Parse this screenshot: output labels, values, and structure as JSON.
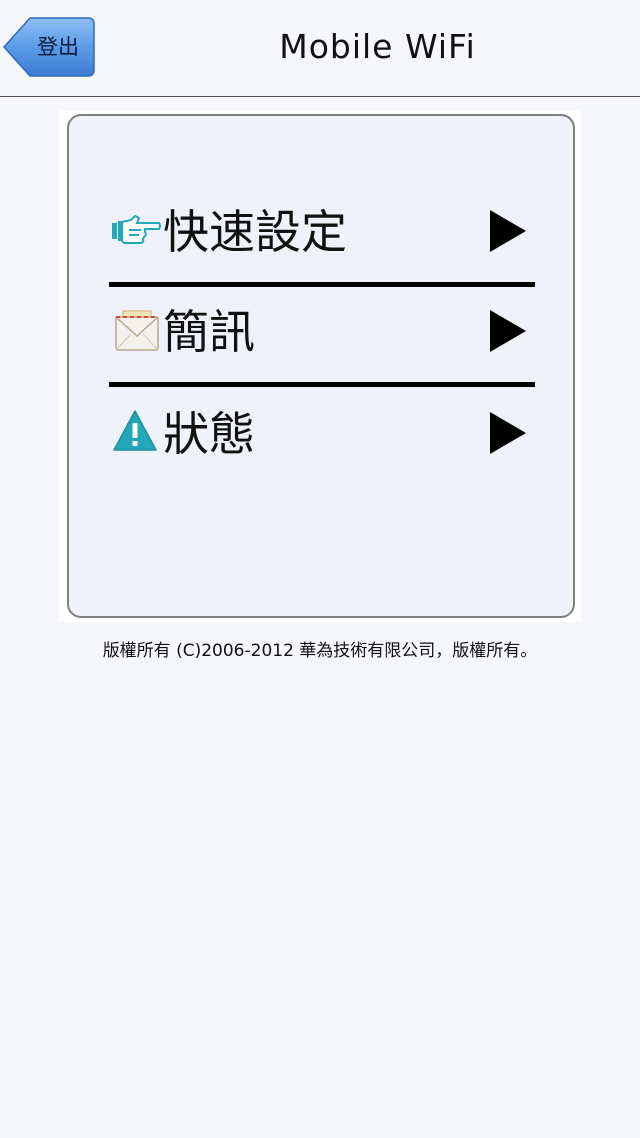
{
  "header": {
    "back_label": "登出",
    "title": "Mobile WiFi"
  },
  "menu": {
    "items": [
      {
        "label": "快速設定",
        "icon": "pointing-hand-icon"
      },
      {
        "label": "簡訊",
        "icon": "envelope-icon"
      },
      {
        "label": "狀態",
        "icon": "warning-icon"
      }
    ]
  },
  "footer": {
    "copyright": "版權所有 (C)2006-2012 華為技術有限公司，版權所有。"
  },
  "colors": {
    "background": "#f6f7fb",
    "card": "#eff2fa",
    "back_button": "#4a8ee0",
    "icon_teal": "#23a8b8"
  }
}
